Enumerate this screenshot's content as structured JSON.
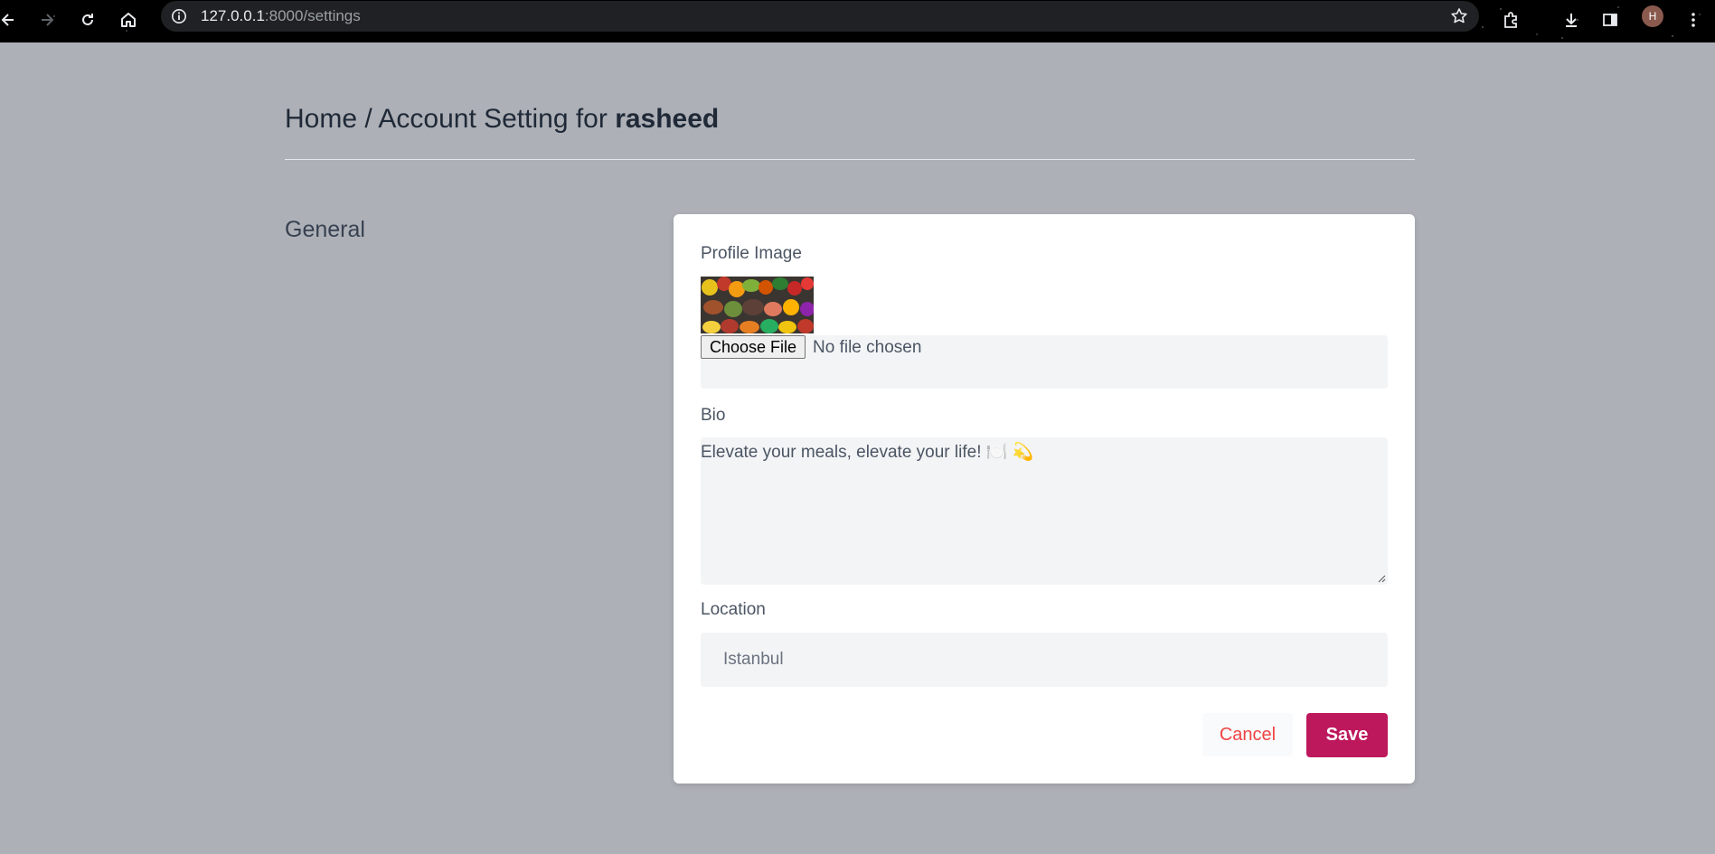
{
  "browser": {
    "url_host": "127.0.0.1",
    "url_rest": ":8000/settings",
    "profile_initial": "H"
  },
  "page": {
    "breadcrumb_prefix": "Home / Account Setting for ",
    "username": "rasheed",
    "section_title": "General"
  },
  "form": {
    "profile_image_label": "Profile Image",
    "choose_file_label": "Choose File",
    "no_file_text": "No file chosen",
    "bio_label": "Bio",
    "bio_value": "Elevate your meals, elevate your life! 🍽️ 💫",
    "location_label": "Location",
    "location_value": "Istanbul",
    "cancel_label": "Cancel",
    "save_label": "Save"
  },
  "colors": {
    "page_background": "#adb0b6",
    "save_button": "#be185d",
    "cancel_text": "#ef4444"
  }
}
